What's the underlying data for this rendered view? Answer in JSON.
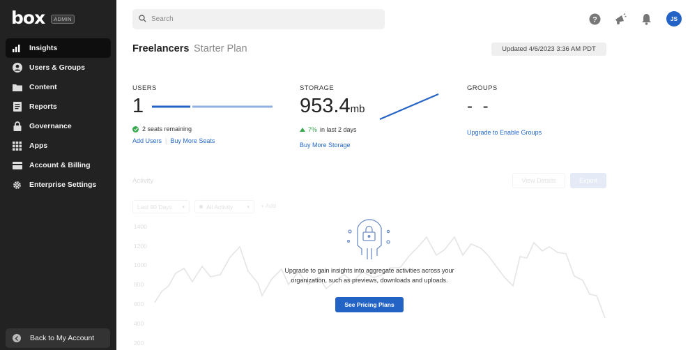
{
  "sidebar": {
    "logo": "box",
    "badge": "ADMIN",
    "items": [
      {
        "label": "Insights",
        "icon": "bar-chart-icon",
        "active": true
      },
      {
        "label": "Users & Groups",
        "icon": "user-icon"
      },
      {
        "label": "Content",
        "icon": "folder-icon"
      },
      {
        "label": "Reports",
        "icon": "report-icon"
      },
      {
        "label": "Governance",
        "icon": "lock-icon"
      },
      {
        "label": "Apps",
        "icon": "grid-icon"
      },
      {
        "label": "Account & Billing",
        "icon": "card-icon"
      },
      {
        "label": "Enterprise Settings",
        "icon": "gear-icon"
      }
    ],
    "back_label": "Back to My Account"
  },
  "topbar": {
    "search_placeholder": "Search",
    "avatar_initials": "JS"
  },
  "heading": {
    "org": "Freelancers",
    "plan": "Starter Plan",
    "updated": "Updated 4/6/2023 3:36 AM PDT"
  },
  "stats": {
    "users": {
      "label": "USERS",
      "value": "1",
      "seats": "2 seats remaining",
      "add_users": "Add Users",
      "buy_seats": "Buy More Seats"
    },
    "storage": {
      "label": "STORAGE",
      "value": "953.4",
      "unit": "mb",
      "growth_pct": "7%",
      "growth_text": "in last 2 days",
      "buy_storage": "Buy More Storage"
    },
    "groups": {
      "label": "GROUPS",
      "value": "- -",
      "upgrade": "Upgrade to Enable Groups"
    }
  },
  "activity": {
    "title": "Activity",
    "view_details": "View Details",
    "export": "Export",
    "filter_range": "Last 90 Days",
    "filter_activity": "All Activity",
    "add_filter": "+ Add",
    "yticks": [
      "1400",
      "1200",
      "1000",
      "800",
      "600",
      "400",
      "200"
    ]
  },
  "upsell": {
    "text": "Upgrade to gain insights into aggregate activities across your organization, such as previews, downloads and uploads.",
    "cta": "See Pricing Plans"
  },
  "colors": {
    "sidebar_bg": "#222222",
    "accent": "#2463c6",
    "link": "#2468c9",
    "success": "#35a94c"
  }
}
